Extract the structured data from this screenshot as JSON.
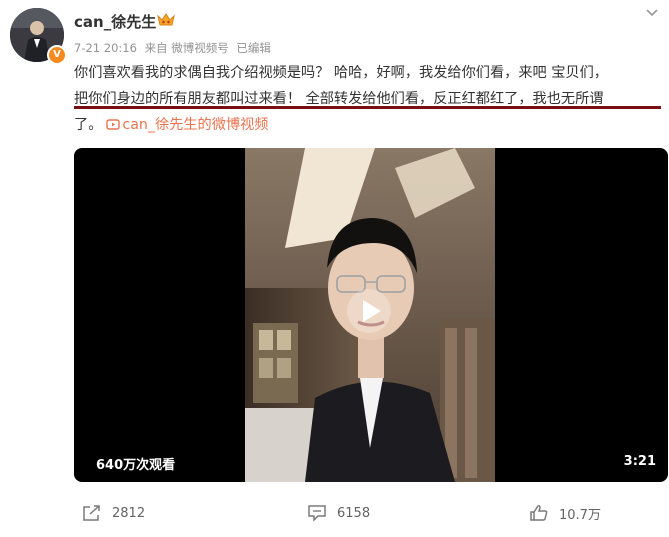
{
  "post": {
    "username": "can_徐先生",
    "time": "7-21 20:16",
    "source": "来自 微博视频号",
    "edited": "已编辑",
    "text_line1": "你们喜欢看我的求偶自我介绍视频是吗？  哈哈，好啊，我发给你们看，来吧 宝贝们，",
    "text_line2": "把你们身边的所有朋友都叫过来看！  全部转发给他们看，反正红都红了，我也无所谓",
    "text_line3": "了。",
    "video_link_text": "can_徐先生的微博视频"
  },
  "video": {
    "view_count": "640万次观看",
    "duration": "3:21"
  },
  "actions": {
    "repost_count": "2812",
    "comment_count": "6158",
    "like_count": "10.7万"
  },
  "colors": {
    "link": "#eb7350",
    "underline": "#7a0f12",
    "badge": "#f78b1f"
  },
  "icons": {
    "verified_badge": "V",
    "crown": "crown-icon",
    "more": "chevron-down-icon",
    "repost": "share-icon",
    "comment": "comment-icon",
    "like": "thumbs-up-icon",
    "play": "play-icon"
  }
}
